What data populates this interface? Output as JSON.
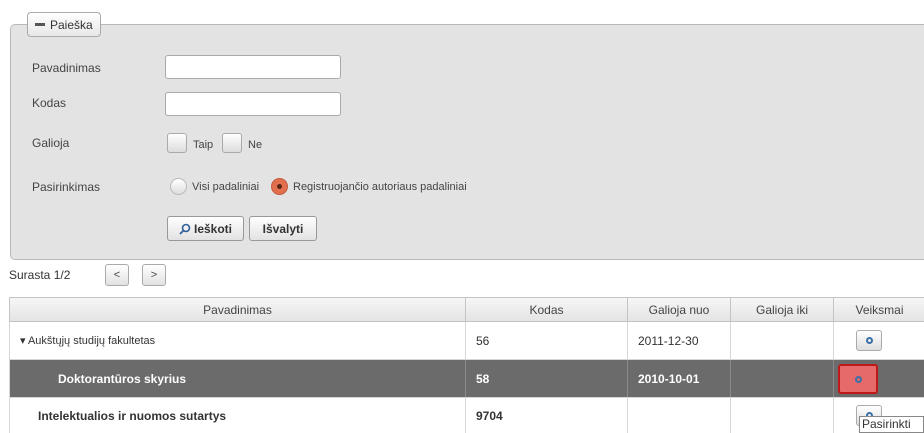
{
  "search_panel": {
    "legend": "Paieška",
    "fields": {
      "name_label": "Pavadinimas",
      "name_value": "",
      "code_label": "Kodas",
      "code_value": "",
      "valid_label": "Galioja",
      "valid_yes": "Taip",
      "valid_no": "Ne",
      "choice_label": "Pasirinkimas",
      "choice_all": "Visi padaliniai",
      "choice_author": "Registruojančio autoriaus padaliniai",
      "choice_selected": "Registruojančio autoriaus padaliniai"
    },
    "search_button": "Ieškoti",
    "clear_button": "Išvalyti"
  },
  "pager": {
    "found_label": "Surasta 1/2",
    "prev": "<",
    "next": ">"
  },
  "table": {
    "columns": [
      "Pavadinimas",
      "Kodas",
      "Galioja nuo",
      "Galioja iki",
      "Veiksmai"
    ],
    "rows": [
      {
        "name": "▾ Aukštųjų studijų fakultetas",
        "code": "56",
        "from": "2011-12-30",
        "to": ""
      },
      {
        "name": "Doktorantūros skyrius",
        "code": "58",
        "from": "2010-10-01",
        "to": ""
      },
      {
        "name": "Intelektualios ir nuomos sutartys",
        "code": "9704",
        "from": "",
        "to": ""
      }
    ]
  },
  "tooltip": "Pasirinkti"
}
